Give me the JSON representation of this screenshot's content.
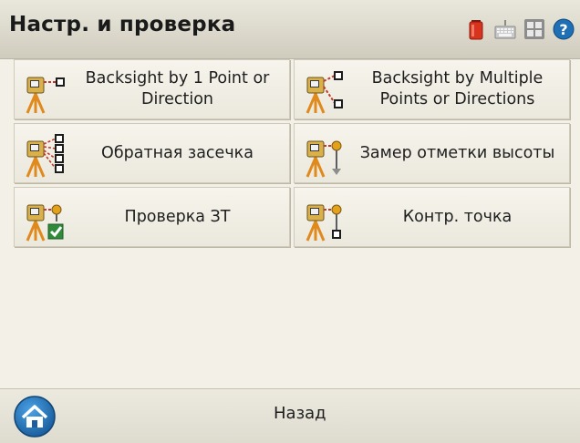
{
  "window": {
    "title": "Настр. и проверка",
    "status_icons": [
      "battery-icon",
      "keyboard-icon",
      "grid-apps-icon",
      "help-icon"
    ]
  },
  "menu": {
    "items": [
      {
        "label": "Backsight by 1 Point or Direction",
        "icon": "total-station-one-point-icon"
      },
      {
        "label": "Backsight by Multiple Points or Directions",
        "icon": "total-station-multiple-points-icon"
      },
      {
        "label": "Обратная засечка",
        "icon": "resection-icon"
      },
      {
        "label": "Замер отметки высоты",
        "icon": "elevation-measure-icon"
      },
      {
        "label": "Проверка ЗТ",
        "icon": "backsight-check-icon"
      },
      {
        "label": "Контр. точка",
        "icon": "check-point-icon"
      }
    ]
  },
  "footer": {
    "back_label": "Назад",
    "home_icon": "home-icon"
  },
  "colors": {
    "background": "#f3f1e7",
    "tripod": "#e08a1e",
    "instrument": "#d9b04a",
    "dotted_line": "#c0392b",
    "help_blue": "#1f6fb5"
  }
}
